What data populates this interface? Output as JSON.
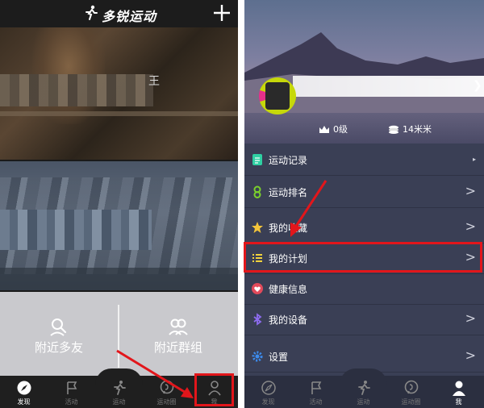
{
  "left": {
    "app_title": "多锐运动",
    "card1_char": "王",
    "nearby_friends_label": "附近多友",
    "nearby_groups_label": "附近群组",
    "tabs": [
      {
        "label": "发现",
        "icon": "compass-icon",
        "active": true
      },
      {
        "label": "活动",
        "icon": "flag-icon",
        "active": false
      },
      {
        "label": "运动",
        "icon": "runner-icon",
        "active": false
      },
      {
        "label": "运动圈",
        "icon": "chat-bubble-icon",
        "active": false
      },
      {
        "label": "我",
        "icon": "person-icon",
        "active": false
      }
    ]
  },
  "right": {
    "level_label": "0级",
    "distance_label": "14米米",
    "menu": [
      {
        "label": "运动记录",
        "icon": "clipboard-icon",
        "color": "#2fd0a3"
      },
      {
        "label": "运动排名",
        "icon": "medal-icon",
        "color": "#7bd12c"
      },
      {
        "label": "我的收藏",
        "icon": "star-icon",
        "color": "#f3c43a"
      },
      {
        "label": "我的计划",
        "icon": "list-icon",
        "color": "#f1d23d"
      },
      {
        "label": "健康信息",
        "icon": "heart-icon",
        "color": "#e24a5b"
      },
      {
        "label": "我的设备",
        "icon": "bluetooth-icon",
        "color": "#8e6cf0"
      },
      {
        "label": "设置",
        "icon": "gear-icon",
        "color": "#3c8cf0"
      }
    ],
    "tabs": [
      {
        "label": "发现",
        "icon": "compass-icon",
        "active": false
      },
      {
        "label": "活动",
        "icon": "flag-icon",
        "active": false
      },
      {
        "label": "运动",
        "icon": "runner-icon",
        "active": false
      },
      {
        "label": "运动圈",
        "icon": "chat-bubble-icon",
        "active": false
      },
      {
        "label": "我",
        "icon": "person-icon",
        "active": true
      }
    ]
  },
  "annotation_color": "#e2161b"
}
